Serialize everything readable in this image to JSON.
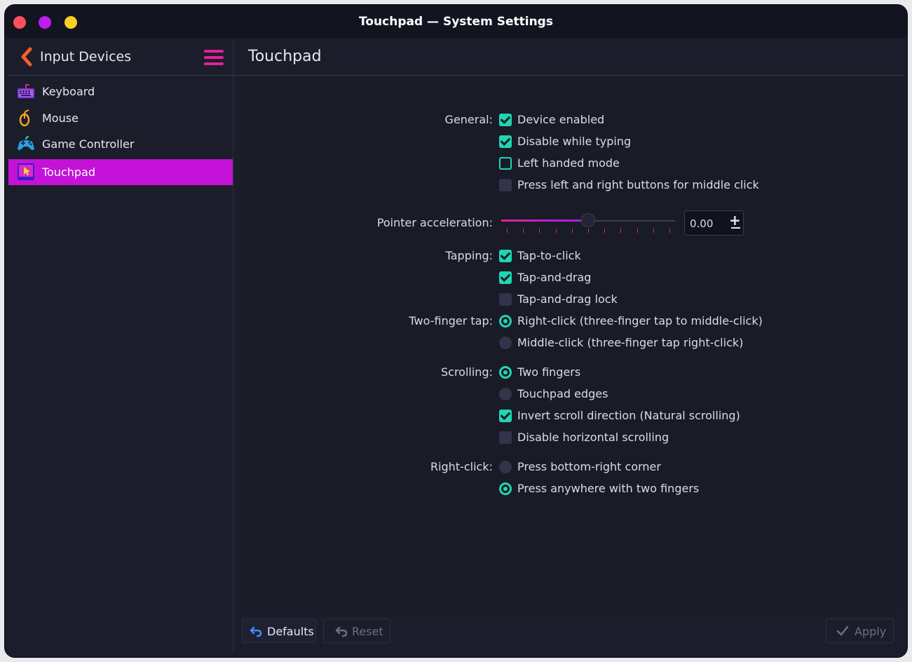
{
  "window": {
    "title": "Touchpad — System Settings"
  },
  "sidebar": {
    "title": "Input Devices",
    "items": [
      {
        "label": "Keyboard",
        "icon": "keyboard-icon"
      },
      {
        "label": "Mouse",
        "icon": "mouse-icon"
      },
      {
        "label": "Game Controller",
        "icon": "gamepad-icon"
      },
      {
        "label": "Touchpad",
        "icon": "touchpad-icon",
        "active": true
      }
    ]
  },
  "page": {
    "title": "Touchpad"
  },
  "settings": {
    "general": {
      "label": "General:",
      "device_enabled": "Device enabled",
      "disable_while_typing": "Disable while typing",
      "left_handed": "Left handed mode",
      "middle_click": "Press left and right buttons for middle click"
    },
    "pointer": {
      "label": "Pointer acceleration:",
      "value": "0.00",
      "slider_fraction": 0.5
    },
    "tapping": {
      "label": "Tapping:",
      "tap_to_click": "Tap-to-click",
      "tap_and_drag": "Tap-and-drag",
      "tap_and_drag_lock": "Tap-and-drag lock"
    },
    "two_finger_tap": {
      "label": "Two-finger tap:",
      "right_click": "Right-click (three-finger tap to middle-click)",
      "middle_click": "Middle-click (three-finger tap right-click)"
    },
    "scrolling": {
      "label": "Scrolling:",
      "two_fingers": "Two fingers",
      "edges": "Touchpad edges",
      "invert": "Invert scroll direction (Natural scrolling)",
      "disable_horizontal": "Disable horizontal scrolling"
    },
    "right_click": {
      "label": "Right-click:",
      "corner": "Press bottom-right corner",
      "two_fingers": "Press anywhere with two fingers"
    }
  },
  "footer": {
    "defaults": "Defaults",
    "reset": "Reset",
    "apply": "Apply"
  },
  "colors": {
    "accent": "#1fd6b4",
    "highlight": "#c412d8",
    "background": "#1b1d2a"
  }
}
